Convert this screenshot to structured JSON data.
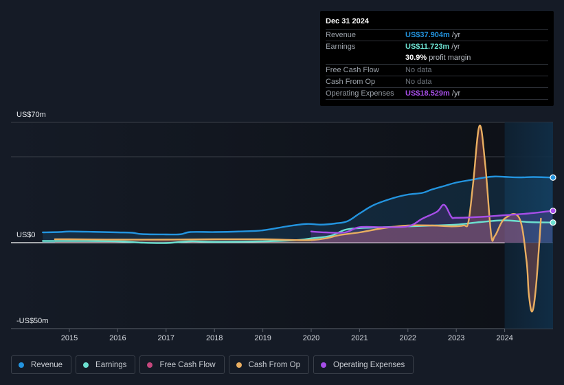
{
  "tooltip": {
    "date": "Dec 31 2024",
    "rows": [
      {
        "label": "Revenue",
        "value": "US$37.904m",
        "unit": "/yr",
        "color": "#2394df"
      },
      {
        "label": "Earnings",
        "value": "US$11.723m",
        "unit": "/yr",
        "color": "#6ce0d0"
      },
      {
        "label": "",
        "value": "30.9%",
        "unit": "profit margin",
        "color": "#ffffff"
      },
      {
        "label": "Free Cash Flow",
        "value": "",
        "unit": "No data",
        "color": "#6e747c"
      },
      {
        "label": "Cash From Op",
        "value": "",
        "unit": "No data",
        "color": "#6e747c"
      },
      {
        "label": "Operating Expenses",
        "value": "US$18.529m",
        "unit": "/yr",
        "color": "#a64ee8"
      }
    ]
  },
  "legend": [
    {
      "label": "Revenue",
      "color": "#2394df"
    },
    {
      "label": "Earnings",
      "color": "#6ce0d0"
    },
    {
      "label": "Free Cash Flow",
      "color": "#c4477d"
    },
    {
      "label": "Cash From Op",
      "color": "#e9ae61"
    },
    {
      "label": "Operating Expenses",
      "color": "#a64ee8"
    }
  ],
  "chart_data": {
    "type": "line",
    "title": "",
    "xlabel": "",
    "ylabel": "",
    "ylim": [
      -50,
      70
    ],
    "xlim": [
      2014.3,
      2024.99
    ],
    "y_tick_labels": [
      {
        "value": 70,
        "label": "US$70m"
      },
      {
        "value": 0,
        "label": "US$0"
      },
      {
        "value": -50,
        "label": "-US$50m"
      }
    ],
    "gridlines": [
      70,
      50,
      0
    ],
    "x_tick_labels": [
      "2015",
      "2016",
      "2017",
      "2018",
      "2019",
      "2020",
      "2021",
      "2022",
      "2023",
      "2024"
    ],
    "x_ticks": [
      2015,
      2016,
      2017,
      2018,
      2019,
      2020,
      2021,
      2022,
      2023,
      2024
    ],
    "forecast_shade_from": 2024.0,
    "series": [
      {
        "name": "Revenue",
        "color": "#2394df",
        "x": [
          2014.45,
          2014.8,
          2015.0,
          2015.5,
          2016.0,
          2016.3,
          2016.5,
          2017.0,
          2017.3,
          2017.5,
          2018.0,
          2018.5,
          2019.0,
          2019.5,
          2019.9,
          2020.2,
          2020.5,
          2020.75,
          2021.0,
          2021.3,
          2021.7,
          2022.0,
          2022.3,
          2022.5,
          2022.75,
          2023.0,
          2023.3,
          2023.6,
          2023.8,
          2024.0,
          2024.3,
          2024.6,
          2024.99
        ],
        "y": [
          6.0,
          6.2,
          6.5,
          6.3,
          6.0,
          5.8,
          5.0,
          4.8,
          4.9,
          6.2,
          6.2,
          6.5,
          7.2,
          9.5,
          10.9,
          10.5,
          11.2,
          12.5,
          17.0,
          22.0,
          26.0,
          28.0,
          29.0,
          31.0,
          33.0,
          35.0,
          36.5,
          38.0,
          38.5,
          38.3,
          38.0,
          38.2,
          37.904
        ]
      },
      {
        "name": "Earnings",
        "color": "#6ce0d0",
        "x": [
          2014.45,
          2015.0,
          2016.0,
          2016.5,
          2017.0,
          2017.5,
          2018.0,
          2019.0,
          2019.7,
          2020.0,
          2020.4,
          2020.7,
          2021.0,
          2021.5,
          2022.0,
          2022.5,
          2023.0,
          2023.5,
          2024.0,
          2024.5,
          2024.99
        ],
        "y": [
          1.0,
          1.0,
          0.8,
          0.0,
          -0.2,
          0.8,
          0.5,
          0.8,
          1.5,
          2.5,
          4.0,
          7.5,
          8.5,
          9.0,
          9.5,
          10.0,
          10.5,
          12.0,
          13.0,
          12.0,
          11.723
        ]
      },
      {
        "name": "Free Cash Flow",
        "color": "#c4477d",
        "x": [],
        "y": []
      },
      {
        "name": "Cash From Op",
        "color": "#e9ae61",
        "x": [
          2014.7,
          2015.0,
          2016.0,
          2017.0,
          2018.0,
          2019.0,
          2019.7,
          2020.0,
          2020.3,
          2020.6,
          2021.0,
          2021.5,
          2022.0,
          2022.5,
          2022.9,
          2023.15,
          2023.25,
          2023.35,
          2023.48,
          2023.6,
          2023.72,
          2023.8,
          2024.0,
          2024.3,
          2024.45,
          2024.5,
          2024.57,
          2024.65,
          2024.75
        ],
        "y": [
          2.0,
          2.0,
          1.8,
          1.8,
          2.0,
          2.0,
          1.5,
          1.5,
          2.5,
          4.5,
          6.0,
          8.5,
          10.0,
          10.0,
          9.5,
          10.0,
          12.0,
          35.0,
          68.0,
          45.0,
          5.0,
          4.0,
          14.0,
          14.5,
          -10.0,
          -30.0,
          -40.0,
          -25.0,
          14.0
        ]
      },
      {
        "name": "Operating Expenses",
        "color": "#a64ee8",
        "x": [
          2020.0,
          2020.3,
          2020.7,
          2021.0,
          2021.5,
          2022.0,
          2022.3,
          2022.6,
          2022.75,
          2022.9,
          2023.0,
          2023.5,
          2024.0,
          2024.5,
          2024.99
        ],
        "y": [
          6.5,
          6.0,
          6.0,
          9.0,
          9.0,
          9.5,
          14.0,
          18.0,
          22.0,
          15.0,
          14.5,
          15.0,
          16.0,
          17.0,
          18.529
        ]
      }
    ],
    "end_markers": [
      "Revenue",
      "Earnings",
      "Operating Expenses"
    ]
  }
}
